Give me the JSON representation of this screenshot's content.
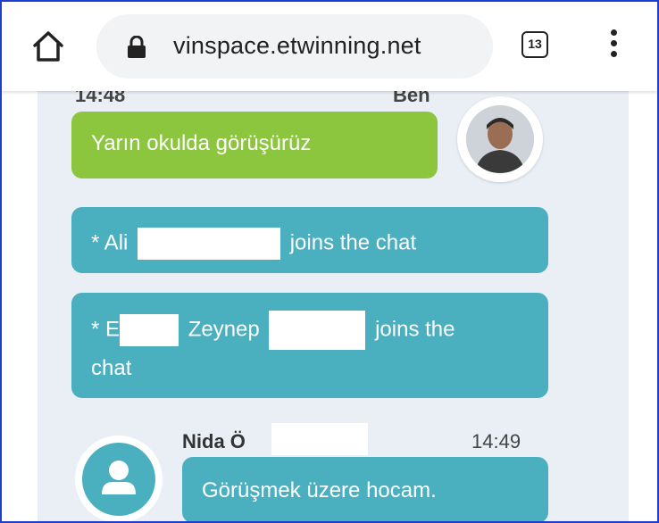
{
  "browser": {
    "url": "vinspace.etwinning.net",
    "tab_count": "13",
    "icons": {
      "home": "home-icon",
      "lock": "lock-icon",
      "menu": "more-vert-icon"
    }
  },
  "chat": {
    "cut_top_time": "14:48",
    "cut_top_sender": "Ben",
    "messages": [
      {
        "type": "own",
        "text": "Yarın okulda görüşürüz"
      },
      {
        "type": "system",
        "prefix": "* Ali",
        "suffix": "joins the chat"
      },
      {
        "type": "system",
        "prefix": "* E",
        "middle": "Zeynep",
        "suffix": "joins the",
        "suffix2": "chat"
      },
      {
        "type": "incoming",
        "sender": "Nida Ö",
        "time": "14:49",
        "text": "Görüşmek üzere hocam."
      }
    ]
  },
  "colors": {
    "own_bubble": "#8cc63f",
    "system_bubble": "#4aafbf",
    "chat_background": "#e9eff5",
    "frame_border": "#1f3ecf"
  }
}
